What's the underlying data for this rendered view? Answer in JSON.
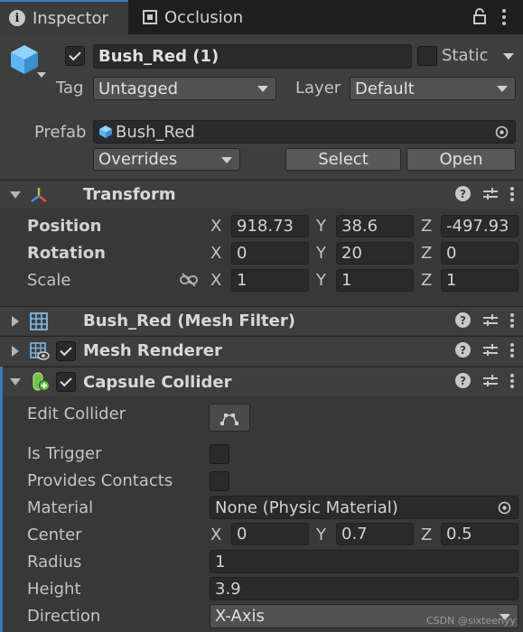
{
  "tabs": [
    {
      "label": "Inspector",
      "icon": "info-icon",
      "active": true
    },
    {
      "label": "Occlusion",
      "icon": "occlusion-icon",
      "active": false
    }
  ],
  "object": {
    "name": "Bush_Red (1)",
    "active": true,
    "static_label": "Static",
    "static": false,
    "tag_label": "Tag",
    "tag_value": "Untagged",
    "layer_label": "Layer",
    "layer_value": "Default",
    "prefab_label": "Prefab",
    "prefab_value": "Bush_Red",
    "overrides_label": "Overrides",
    "select_label": "Select",
    "open_label": "Open"
  },
  "transform": {
    "title": "Transform",
    "position_label": "Position",
    "rotation_label": "Rotation",
    "scale_label": "Scale",
    "axis_x": "X",
    "axis_y": "Y",
    "axis_z": "Z",
    "position": {
      "x": "918.73",
      "y": "38.6",
      "z": "-497.93"
    },
    "rotation": {
      "x": "0",
      "y": "20",
      "z": "0"
    },
    "scale": {
      "x": "1",
      "y": "1",
      "z": "1"
    }
  },
  "mesh_filter": {
    "title": "Bush_Red (Mesh Filter)"
  },
  "mesh_renderer": {
    "title": "Mesh Renderer",
    "enabled": true
  },
  "capsule_collider": {
    "title": "Capsule Collider",
    "enabled": true,
    "edit_collider_label": "Edit Collider",
    "is_trigger_label": "Is Trigger",
    "provides_contacts_label": "Provides Contacts",
    "material_label": "Material",
    "material_value": "None (Physic Material)",
    "center_label": "Center",
    "center": {
      "x": "0",
      "y": "0.7",
      "z": "0.5"
    },
    "radius_label": "Radius",
    "radius_value": "1",
    "height_label": "Height",
    "height_value": "3.9",
    "direction_label": "Direction",
    "direction_value": "X-Axis"
  },
  "watermark": "CSDN @sixteenyy",
  "colors": {
    "accent": "#3a79bb",
    "background": "#383838",
    "header": "#3e3e3e",
    "tabbar": "#1e1e1e",
    "cube_icon": "#5cb7f2",
    "collider_icon": "#8ad04d"
  }
}
